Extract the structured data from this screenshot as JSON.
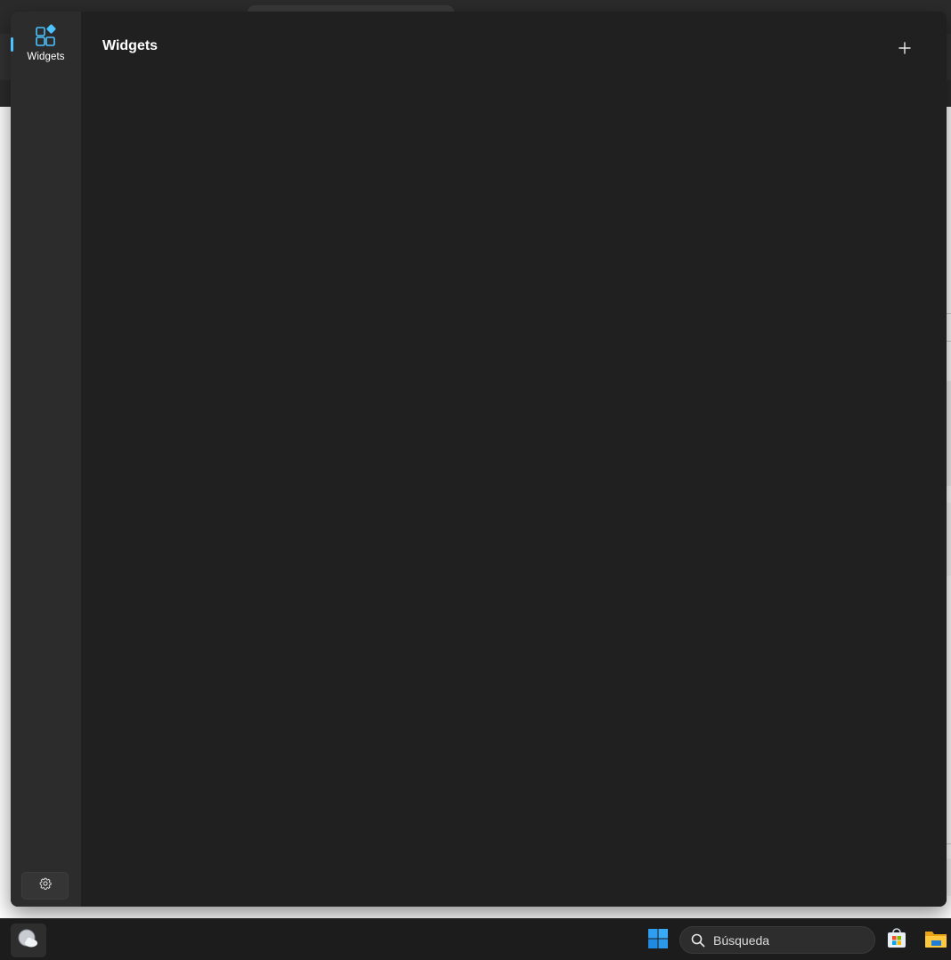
{
  "widgets_board": {
    "rail": {
      "items": [
        {
          "label": "Widgets",
          "icon": "widgets-icon",
          "selected": true
        }
      ],
      "settings_icon": "gear-icon"
    },
    "main": {
      "title": "Widgets",
      "add_icon": "plus-icon"
    },
    "colors": {
      "accent": "#4cc2ff",
      "board_bg": "#202020",
      "rail_bg": "#2c2c2c"
    }
  },
  "taskbar": {
    "weather_icon": "weather-cloud-icon",
    "start_icon": "windows-logo-icon",
    "search": {
      "placeholder": "Búsqueda",
      "icon": "search-icon"
    },
    "pinned": [
      {
        "name": "Microsoft Store",
        "icon": "store-icon"
      },
      {
        "name": "File Explorer",
        "icon": "folder-icon"
      }
    ]
  }
}
